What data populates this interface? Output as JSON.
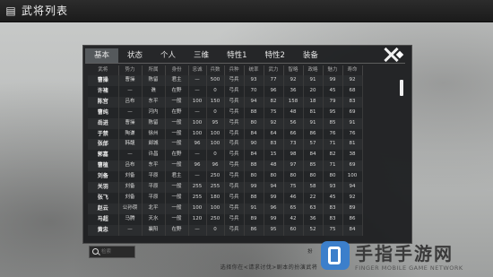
{
  "window": {
    "title": "武将列表"
  },
  "tabs": [
    {
      "label": "基本",
      "active": true
    },
    {
      "label": "状态",
      "active": false
    },
    {
      "label": "个人",
      "active": false
    },
    {
      "label": "三维",
      "active": false
    },
    {
      "label": "特性1",
      "active": false
    },
    {
      "label": "特性2",
      "active": false
    },
    {
      "label": "装备",
      "active": false
    }
  ],
  "table": {
    "columns": [
      "武将",
      "势力",
      "所属",
      "身份",
      "忠诚",
      "兵数",
      "兵种",
      "统率",
      "武力",
      "智略",
      "政略",
      "魅力",
      "寿命"
    ],
    "rows": [
      [
        "曹操",
        "曹操",
        "陈留",
        "君主",
        "—",
        "500",
        "弓兵",
        "93",
        "77",
        "92",
        "91",
        "99",
        "92"
      ],
      [
        "许褚",
        "—",
        "谯",
        "在野",
        "—",
        "0",
        "弓兵",
        "70",
        "96",
        "36",
        "20",
        "45",
        "68"
      ],
      [
        "陈宫",
        "吕布",
        "东平",
        "一般",
        "100",
        "150",
        "弓兵",
        "94",
        "82",
        "158",
        "18",
        "79",
        "83"
      ],
      [
        "曹纯",
        "—",
        "河内",
        "在野",
        "—",
        "0",
        "弓兵",
        "88",
        "75",
        "48",
        "81",
        "95",
        "69"
      ],
      [
        "岳进",
        "曹操",
        "陈留",
        "一般",
        "100",
        "95",
        "弓兵",
        "80",
        "92",
        "56",
        "91",
        "85",
        "91"
      ],
      [
        "于禁",
        "陶谦",
        "徐州",
        "一般",
        "100",
        "100",
        "弓兵",
        "84",
        "64",
        "66",
        "86",
        "76",
        "76"
      ],
      [
        "张郃",
        "韩馥",
        "邺城",
        "一般",
        "96",
        "100",
        "弓兵",
        "90",
        "83",
        "73",
        "57",
        "71",
        "81"
      ],
      [
        "郭嘉",
        "—",
        "许昌",
        "在野",
        "—",
        "0",
        "弓兵",
        "84",
        "15",
        "98",
        "84",
        "82",
        "38"
      ],
      [
        "曹植",
        "吕布",
        "东平",
        "一般",
        "96",
        "96",
        "弓兵",
        "88",
        "48",
        "97",
        "85",
        "71",
        "69"
      ],
      [
        "刘备",
        "刘备",
        "平原",
        "君主",
        "—",
        "250",
        "弓兵",
        "80",
        "80",
        "80",
        "80",
        "80",
        "100"
      ],
      [
        "关羽",
        "刘备",
        "平原",
        "一般",
        "255",
        "255",
        "弓兵",
        "99",
        "94",
        "75",
        "58",
        "93",
        "94"
      ],
      [
        "张飞",
        "刘备",
        "平原",
        "一般",
        "255",
        "180",
        "弓兵",
        "88",
        "99",
        "46",
        "22",
        "45",
        "92"
      ],
      [
        "赵云",
        "公孙瓒",
        "北平",
        "一般",
        "100",
        "100",
        "弓兵",
        "91",
        "96",
        "65",
        "63",
        "83",
        "89"
      ],
      [
        "马超",
        "马腾",
        "天水",
        "一般",
        "120",
        "250",
        "弓兵",
        "89",
        "99",
        "42",
        "36",
        "83",
        "86"
      ],
      [
        "黄忠",
        "—",
        "襄阳",
        "在野",
        "—",
        "0",
        "弓兵",
        "86",
        "95",
        "60",
        "52",
        "75",
        "84"
      ]
    ]
  },
  "search": {
    "placeholder": "检索"
  },
  "hint": {
    "text": "选择你在<请求讨伐>剧本的扮演武将"
  },
  "side_snippet": {
    "text": "扮"
  },
  "watermark": {
    "main": "手指手游网",
    "sub": "FINGER MOBILE GAME NETWORK"
  },
  "colors": {
    "panel": "#1c1d1f",
    "tab_active": "#55595c",
    "titlebar": "#1b1b1b"
  }
}
